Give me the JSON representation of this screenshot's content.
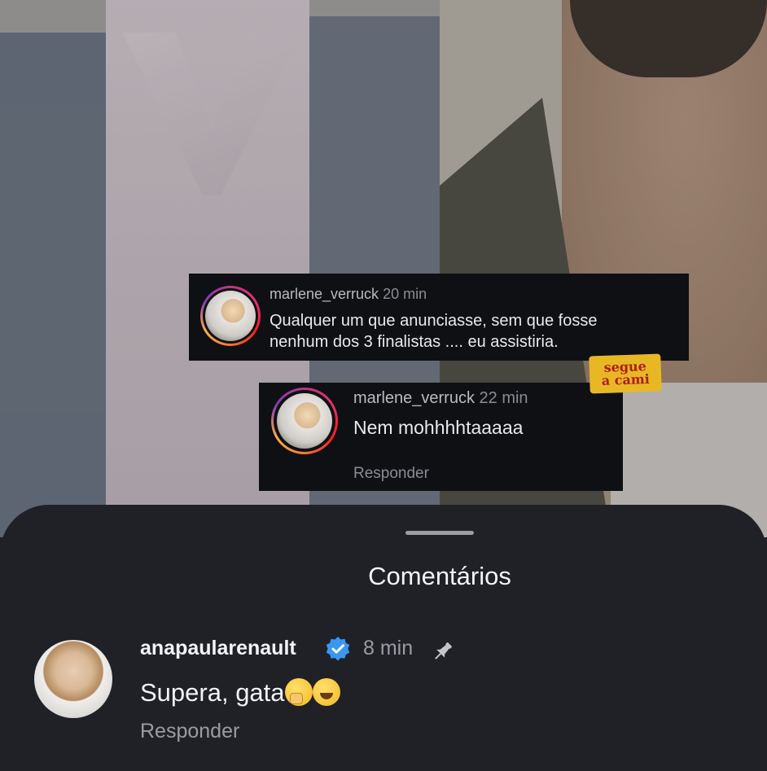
{
  "overlay": {
    "comment_1": {
      "username": "marlene_verruck",
      "time": "20 min",
      "text_line1": "Qualquer um que anunciasse, sem que fosse",
      "text_line2": "nenhum dos 3 finalistas .... eu assistiria."
    },
    "comment_2": {
      "username": "marlene_verruck",
      "time": "22 min",
      "text": "Nem mohhhhtaaaaa",
      "reply_label": "Responder"
    },
    "sticker": {
      "line1": "segue",
      "line2": "a cami"
    }
  },
  "sheet": {
    "title": "Comentários",
    "comment": {
      "username": "anapaularenault",
      "time": "8 min",
      "text": "Supera, gata",
      "emojis": [
        "🤭",
        "😅"
      ],
      "reply_label": "Responder"
    }
  },
  "colors": {
    "sheet_bg": "#1f2127",
    "verified_blue": "#3897f0",
    "sticker_yellow": "#e8b824"
  },
  "icons": [
    "verified-badge-icon",
    "pin-icon"
  ]
}
